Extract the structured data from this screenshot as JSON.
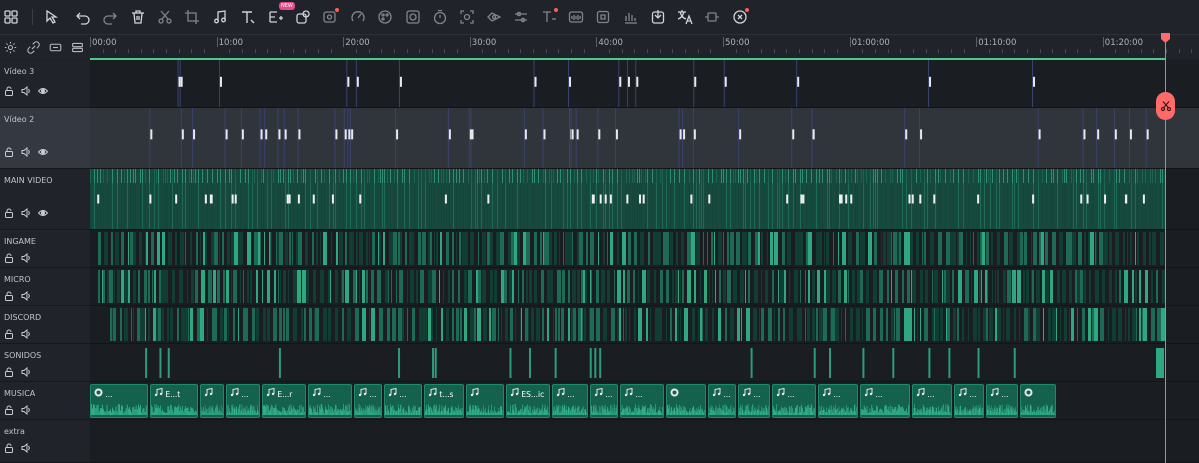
{
  "toolbar": {
    "new_badge": "NEW",
    "buttons": [
      {
        "name": "layout-grid-icon",
        "enabled": true
      },
      {
        "name": "select-pointer-icon",
        "enabled": true
      },
      {
        "name": "undo-icon",
        "enabled": true
      },
      {
        "name": "redo-icon",
        "enabled": false
      },
      {
        "name": "delete-icon",
        "enabled": true
      },
      {
        "name": "cut-icon",
        "enabled": false
      },
      {
        "name": "crop-icon",
        "enabled": false
      },
      {
        "name": "audio-icon",
        "enabled": true
      },
      {
        "name": "text-icon",
        "enabled": true
      },
      {
        "name": "ai-text-icon",
        "enabled": true
      },
      {
        "name": "shape-icon",
        "enabled": true
      },
      {
        "name": "effects-icon",
        "enabled": false
      },
      {
        "name": "speed-icon",
        "enabled": false
      },
      {
        "name": "color-icon",
        "enabled": false
      },
      {
        "name": "mask-icon",
        "enabled": false
      },
      {
        "name": "timer-icon",
        "enabled": false
      },
      {
        "name": "stabilize-icon",
        "enabled": false
      },
      {
        "name": "motion-icon",
        "enabled": false
      },
      {
        "name": "adjust-icon",
        "enabled": false
      },
      {
        "name": "text-effect-icon",
        "enabled": false
      },
      {
        "name": "subtitle-icon",
        "enabled": false
      },
      {
        "name": "freeze-icon",
        "enabled": false
      },
      {
        "name": "audio-stretch-icon",
        "enabled": false
      },
      {
        "name": "export-clip-icon",
        "enabled": true
      },
      {
        "name": "translate-icon",
        "enabled": true
      },
      {
        "name": "keyframe-icon",
        "enabled": false
      },
      {
        "name": "ai-tools-icon",
        "enabled": true
      }
    ]
  },
  "ruler": {
    "labels": [
      "00:00",
      "10:00",
      "20:00",
      "30:00",
      "40:00",
      "50:00",
      "01:00:00",
      "01:10:00",
      "01:20:00"
    ]
  },
  "tracks": [
    {
      "id": "video3",
      "name": "Vídeo 3",
      "type": "video"
    },
    {
      "id": "video2",
      "name": "Vídeo 2",
      "type": "video"
    },
    {
      "id": "main",
      "name": "MAIN VIDEO",
      "type": "video"
    },
    {
      "id": "ingame",
      "name": "INGAME",
      "type": "audio"
    },
    {
      "id": "micro",
      "name": "MICRO",
      "type": "audio"
    },
    {
      "id": "discord",
      "name": "DISCORD",
      "type": "audio"
    },
    {
      "id": "sonidos",
      "name": "SONIDOS",
      "type": "audio"
    },
    {
      "id": "musica",
      "name": "MUSICA",
      "type": "audio"
    },
    {
      "id": "extra",
      "name": "extra",
      "type": "audio"
    }
  ],
  "music_clips": [
    {
      "label": "...",
      "icon": "record"
    },
    {
      "label": "E...t",
      "icon": "note"
    },
    {
      "label": "",
      "icon": "note"
    },
    {
      "label": "...",
      "icon": "note"
    },
    {
      "label": "E...r",
      "icon": "note"
    },
    {
      "label": "...",
      "icon": "note"
    },
    {
      "label": "...",
      "icon": "note"
    },
    {
      "label": "...",
      "icon": "note"
    },
    {
      "label": "t...s",
      "icon": "note"
    },
    {
      "label": "",
      "icon": "note"
    },
    {
      "label": "ES...ic",
      "icon": "note"
    },
    {
      "label": "...",
      "icon": "note"
    },
    {
      "label": "...",
      "icon": "note"
    },
    {
      "label": "...",
      "icon": "note"
    },
    {
      "label": "",
      "icon": "record"
    },
    {
      "label": "...",
      "icon": "note"
    },
    {
      "label": "...",
      "icon": "note"
    },
    {
      "label": "...",
      "icon": "note"
    },
    {
      "label": "...",
      "icon": "note"
    },
    {
      "label": "...",
      "icon": "note"
    },
    {
      "label": "...",
      "icon": "note"
    },
    {
      "label": "...",
      "icon": "note"
    },
    {
      "label": "...",
      "icon": "note"
    },
    {
      "label": "",
      "icon": "record"
    }
  ],
  "colors": {
    "accent_green": "#1e8a6c",
    "clip_green": "#14624d",
    "work_area": "#4bc98a",
    "playhead": "#ff6b6b"
  }
}
